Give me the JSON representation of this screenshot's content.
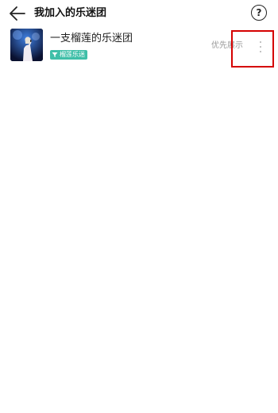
{
  "header": {
    "back_icon": "arrow-left-icon",
    "title": "我加入的乐迷团",
    "help_icon": "question-circle-icon",
    "help_glyph": "?"
  },
  "fan_groups": [
    {
      "name": "一支榴莲的乐迷团",
      "tag_icon": "funnel-icon",
      "tag_label": "榴莲乐迷",
      "tag_color": "#3fbfa8",
      "priority_label": "优先展示",
      "more_icon": "vertical-dots-icon"
    }
  ],
  "colors": {
    "highlight": "#d50000",
    "title": "#111111",
    "secondary_text": "#999999"
  }
}
